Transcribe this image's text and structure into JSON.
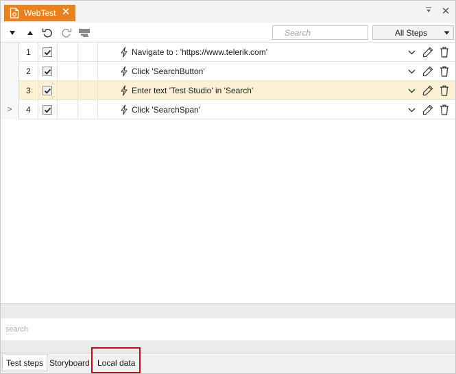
{
  "tab": {
    "title": "WebTest"
  },
  "toolbar": {
    "search_placeholder": "Search",
    "filter_value": "All Steps"
  },
  "rows": [
    {
      "num": "1",
      "desc": "Navigate to : 'https://www.telerik.com'",
      "selected": false,
      "expander": ""
    },
    {
      "num": "2",
      "desc": "Click 'SearchButton'",
      "selected": false,
      "expander": ""
    },
    {
      "num": "3",
      "desc": "Enter text 'Test Studio' in 'Search'",
      "selected": true,
      "expander": ""
    },
    {
      "num": "4",
      "desc": "Click 'SearchSpan'",
      "selected": false,
      "expander": ">"
    }
  ],
  "bottom": {
    "search_placeholder": "search",
    "tabs": [
      "Test steps",
      "Storyboard",
      "Local data"
    ]
  },
  "colors": {
    "accent": "#e8821e",
    "selected_row": "#fdf1d3",
    "highlight": "#b5121b"
  },
  "icons": [
    "document-icon",
    "close-icon",
    "pin-icon",
    "arrow-down-icon",
    "arrow-up-icon",
    "undo-icon",
    "redo-icon",
    "recorder-icon",
    "chevron-down-icon",
    "lightning-icon",
    "pencil-icon",
    "trash-icon"
  ]
}
